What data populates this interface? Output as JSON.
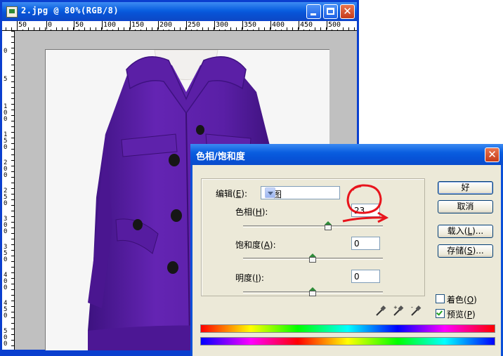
{
  "document": {
    "title": "2.jpg @ 80%(RGB/8)",
    "ruler_h": [
      "50",
      "0",
      "50",
      "100",
      "150",
      "200",
      "250",
      "300",
      "350",
      "400",
      "450",
      "500"
    ],
    "ruler_v": [
      "0",
      "5",
      "1 0 0",
      "1 5 0",
      "2 0 0",
      "2 5 0",
      "3 0 0",
      "3 5 0",
      "4 0 0",
      "4 5 0",
      "5 0 0"
    ]
  },
  "dialog": {
    "title": "色相/饱和度",
    "edit": {
      "label_pre": "编辑(",
      "key": "E",
      "label_post": "):",
      "value": "全图"
    },
    "hue": {
      "label_pre": "色相(",
      "key": "H",
      "label_post": "):",
      "value": "23"
    },
    "saturation": {
      "label_pre": "饱和度(",
      "key": "A",
      "label_post": "):",
      "value": "0"
    },
    "lightness": {
      "label_pre": "明度(",
      "key": "I",
      "label_post": "):",
      "value": "0"
    },
    "buttons": {
      "ok": "好",
      "cancel": "取消",
      "load": {
        "pre": "载入(",
        "key": "L",
        "post": ")..."
      },
      "save": {
        "pre": "存储(",
        "key": "S",
        "post": ")..."
      }
    },
    "colorize": {
      "pre": "着色(",
      "key": "O",
      "post": ")",
      "checked": false
    },
    "preview": {
      "pre": "预览(",
      "key": "P",
      "post": ")",
      "checked": true
    }
  },
  "annotation": {
    "color": "#e8141c"
  },
  "colors": {
    "coat": "#5a1ea8",
    "titlebar": "#0a5fe0",
    "dialog_face": "#ece9d8"
  }
}
